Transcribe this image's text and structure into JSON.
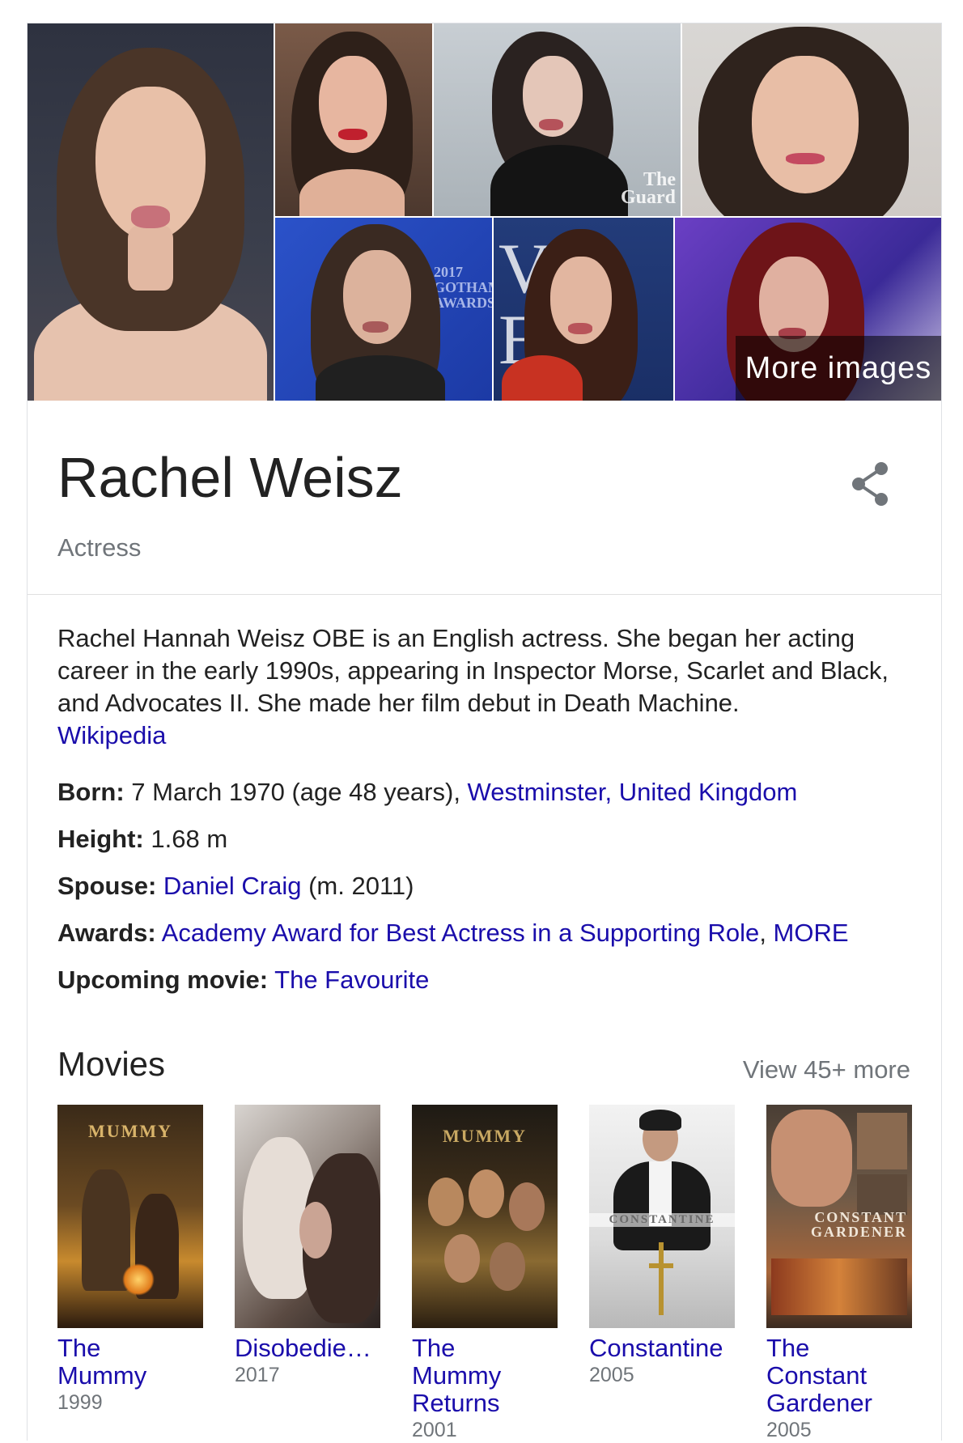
{
  "images": {
    "tiles": [
      {
        "name": "photo-main",
        "alt": "Rachel Weisz portrait"
      },
      {
        "name": "photo-red-lips"
      },
      {
        "name": "photo-guardian"
      },
      {
        "name": "photo-smile"
      },
      {
        "name": "photo-gotham-awards"
      },
      {
        "name": "photo-vogue"
      },
      {
        "name": "photo-red-hair"
      }
    ],
    "guardian_mark": "The\nGuard",
    "gotham_mark": "2017\nGOTHAM\nAWARDS",
    "vogue_mark": "V E",
    "more_images_label": "More images"
  },
  "entity": {
    "name": "Rachel Weisz",
    "type": "Actress",
    "share_icon": "share-icon"
  },
  "description": {
    "text": "Rachel Hannah Weisz OBE is an English actress. She began her acting career in the early 1990s, appearing in Inspector Morse, Scarlet and Black, and Advocates II. She made her film debut in Death Machine.",
    "source_link": "Wikipedia"
  },
  "facts": {
    "born": {
      "label": "Born:",
      "value": " 7 March 1970 (age 48 years), ",
      "place": "Westminster, United Kingdom"
    },
    "height": {
      "label": "Height:",
      "value": " 1.68 m"
    },
    "spouse": {
      "label": "Spouse:",
      "name": "Daniel Craig",
      "detail": " (m. 2011)"
    },
    "awards": {
      "label": "Awards:",
      "award": "Academy Award for Best Actress in a Supporting Role",
      "separator": ", ",
      "more": "MORE"
    },
    "upcoming": {
      "label": "Upcoming movie:",
      "movie": "The Favourite"
    }
  },
  "movies": {
    "title": "Movies",
    "view_more": "View 45+ more",
    "items": [
      {
        "title": "The\nMummy",
        "year": "1999",
        "poster_text": "MUMMY"
      },
      {
        "title": "Disobedie…",
        "year": "2017",
        "poster_text": ""
      },
      {
        "title": "The\nMummy\nReturns",
        "year": "2001",
        "poster_text": "MUMMY"
      },
      {
        "title": "Constantine",
        "year": "2005",
        "poster_text": "CONSTANTINE"
      },
      {
        "title": "The\nConstant\nGardener",
        "year": "2005",
        "poster_text": "CONSTANT\nGARDENER"
      }
    ]
  },
  "colors": {
    "link": "#1a0dab",
    "secondary": "#70757a",
    "text": "#222222",
    "border": "#dfe1e5"
  }
}
